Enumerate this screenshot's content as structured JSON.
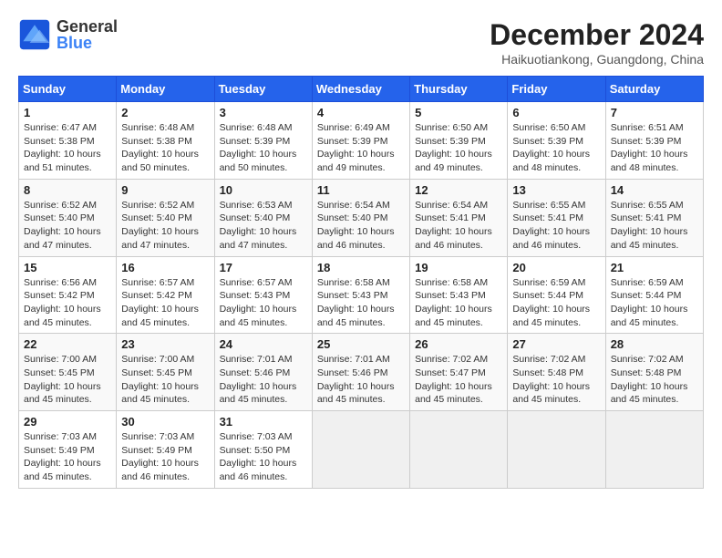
{
  "header": {
    "title": "December 2024",
    "subtitle": "Haikuotiankong, Guangdong, China",
    "logo_line1": "General",
    "logo_line2": "Blue"
  },
  "columns": [
    "Sunday",
    "Monday",
    "Tuesday",
    "Wednesday",
    "Thursday",
    "Friday",
    "Saturday"
  ],
  "weeks": [
    [
      {
        "day": "1",
        "sunrise": "6:47 AM",
        "sunset": "5:38 PM",
        "daylight": "10 hours and 51 minutes."
      },
      {
        "day": "2",
        "sunrise": "6:48 AM",
        "sunset": "5:38 PM",
        "daylight": "10 hours and 50 minutes."
      },
      {
        "day": "3",
        "sunrise": "6:48 AM",
        "sunset": "5:39 PM",
        "daylight": "10 hours and 50 minutes."
      },
      {
        "day": "4",
        "sunrise": "6:49 AM",
        "sunset": "5:39 PM",
        "daylight": "10 hours and 49 minutes."
      },
      {
        "day": "5",
        "sunrise": "6:50 AM",
        "sunset": "5:39 PM",
        "daylight": "10 hours and 49 minutes."
      },
      {
        "day": "6",
        "sunrise": "6:50 AM",
        "sunset": "5:39 PM",
        "daylight": "10 hours and 48 minutes."
      },
      {
        "day": "7",
        "sunrise": "6:51 AM",
        "sunset": "5:39 PM",
        "daylight": "10 hours and 48 minutes."
      }
    ],
    [
      {
        "day": "8",
        "sunrise": "6:52 AM",
        "sunset": "5:40 PM",
        "daylight": "10 hours and 47 minutes."
      },
      {
        "day": "9",
        "sunrise": "6:52 AM",
        "sunset": "5:40 PM",
        "daylight": "10 hours and 47 minutes."
      },
      {
        "day": "10",
        "sunrise": "6:53 AM",
        "sunset": "5:40 PM",
        "daylight": "10 hours and 47 minutes."
      },
      {
        "day": "11",
        "sunrise": "6:54 AM",
        "sunset": "5:40 PM",
        "daylight": "10 hours and 46 minutes."
      },
      {
        "day": "12",
        "sunrise": "6:54 AM",
        "sunset": "5:41 PM",
        "daylight": "10 hours and 46 minutes."
      },
      {
        "day": "13",
        "sunrise": "6:55 AM",
        "sunset": "5:41 PM",
        "daylight": "10 hours and 46 minutes."
      },
      {
        "day": "14",
        "sunrise": "6:55 AM",
        "sunset": "5:41 PM",
        "daylight": "10 hours and 45 minutes."
      }
    ],
    [
      {
        "day": "15",
        "sunrise": "6:56 AM",
        "sunset": "5:42 PM",
        "daylight": "10 hours and 45 minutes."
      },
      {
        "day": "16",
        "sunrise": "6:57 AM",
        "sunset": "5:42 PM",
        "daylight": "10 hours and 45 minutes."
      },
      {
        "day": "17",
        "sunrise": "6:57 AM",
        "sunset": "5:43 PM",
        "daylight": "10 hours and 45 minutes."
      },
      {
        "day": "18",
        "sunrise": "6:58 AM",
        "sunset": "5:43 PM",
        "daylight": "10 hours and 45 minutes."
      },
      {
        "day": "19",
        "sunrise": "6:58 AM",
        "sunset": "5:43 PM",
        "daylight": "10 hours and 45 minutes."
      },
      {
        "day": "20",
        "sunrise": "6:59 AM",
        "sunset": "5:44 PM",
        "daylight": "10 hours and 45 minutes."
      },
      {
        "day": "21",
        "sunrise": "6:59 AM",
        "sunset": "5:44 PM",
        "daylight": "10 hours and 45 minutes."
      }
    ],
    [
      {
        "day": "22",
        "sunrise": "7:00 AM",
        "sunset": "5:45 PM",
        "daylight": "10 hours and 45 minutes."
      },
      {
        "day": "23",
        "sunrise": "7:00 AM",
        "sunset": "5:45 PM",
        "daylight": "10 hours and 45 minutes."
      },
      {
        "day": "24",
        "sunrise": "7:01 AM",
        "sunset": "5:46 PM",
        "daylight": "10 hours and 45 minutes."
      },
      {
        "day": "25",
        "sunrise": "7:01 AM",
        "sunset": "5:46 PM",
        "daylight": "10 hours and 45 minutes."
      },
      {
        "day": "26",
        "sunrise": "7:02 AM",
        "sunset": "5:47 PM",
        "daylight": "10 hours and 45 minutes."
      },
      {
        "day": "27",
        "sunrise": "7:02 AM",
        "sunset": "5:48 PM",
        "daylight": "10 hours and 45 minutes."
      },
      {
        "day": "28",
        "sunrise": "7:02 AM",
        "sunset": "5:48 PM",
        "daylight": "10 hours and 45 minutes."
      }
    ],
    [
      {
        "day": "29",
        "sunrise": "7:03 AM",
        "sunset": "5:49 PM",
        "daylight": "10 hours and 45 minutes."
      },
      {
        "day": "30",
        "sunrise": "7:03 AM",
        "sunset": "5:49 PM",
        "daylight": "10 hours and 46 minutes."
      },
      {
        "day": "31",
        "sunrise": "7:03 AM",
        "sunset": "5:50 PM",
        "daylight": "10 hours and 46 minutes."
      },
      null,
      null,
      null,
      null
    ]
  ]
}
